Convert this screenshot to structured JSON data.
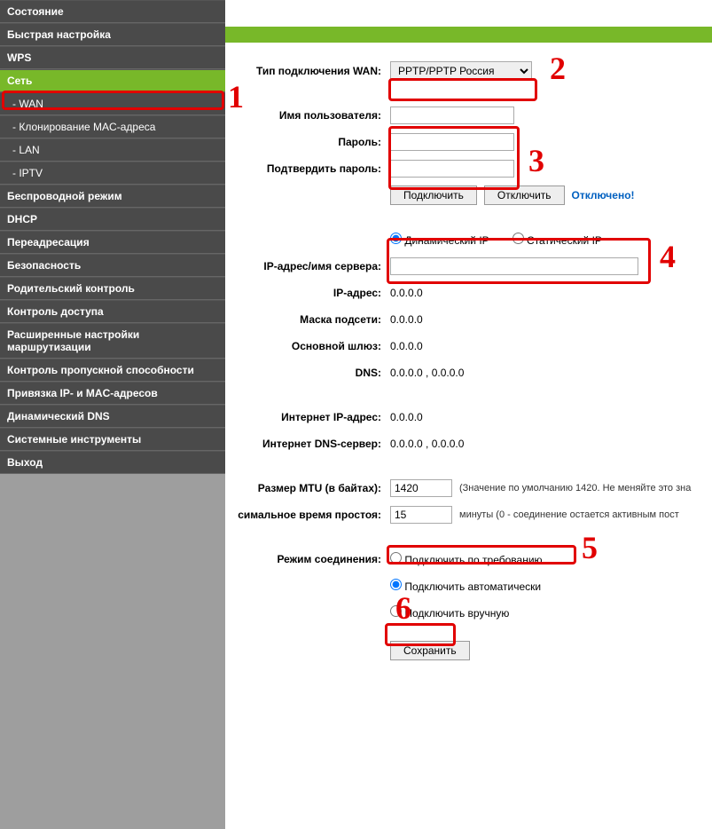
{
  "sidebar": {
    "items": [
      {
        "label": "Состояние",
        "sub": false
      },
      {
        "label": "Быстрая настройка",
        "sub": false
      },
      {
        "label": "WPS",
        "sub": false
      },
      {
        "label": "Сеть",
        "sub": false,
        "active": true
      },
      {
        "label": "- WAN",
        "sub": true,
        "selected": true
      },
      {
        "label": "- Клонирование MAC-адреса",
        "sub": true
      },
      {
        "label": "- LAN",
        "sub": true
      },
      {
        "label": "- IPTV",
        "sub": true
      },
      {
        "label": "Беспроводной режим",
        "sub": false
      },
      {
        "label": "DHCP",
        "sub": false
      },
      {
        "label": "Переадресация",
        "sub": false
      },
      {
        "label": "Безопасность",
        "sub": false
      },
      {
        "label": "Родительский контроль",
        "sub": false
      },
      {
        "label": "Контроль доступа",
        "sub": false
      },
      {
        "label": "Расширенные настройки маршрутизации",
        "sub": false
      },
      {
        "label": "Контроль пропускной способности",
        "sub": false
      },
      {
        "label": "Привязка IP- и MAC-адресов",
        "sub": false
      },
      {
        "label": "Динамический DNS",
        "sub": false
      },
      {
        "label": "Системные инструменты",
        "sub": false
      },
      {
        "label": "Выход",
        "sub": false
      }
    ]
  },
  "form": {
    "wan_type_label": "Тип подключения WAN:",
    "wan_type_value": "PPTP/PPTP Россия",
    "username_label": "Имя пользователя:",
    "username_value": "",
    "password_label": "Пароль:",
    "password_value": "",
    "confirm_label": "Подтвердить пароль:",
    "confirm_value": "",
    "connect_btn": "Подключить",
    "disconnect_btn": "Отключить",
    "status": "Отключено!",
    "dynamic_ip": "Динамический IP",
    "static_ip": "Статический IP",
    "server_label": "IP-адрес/имя сервера:",
    "server_value": "",
    "ip_label": "IP-адрес:",
    "ip_value": "0.0.0.0",
    "mask_label": "Маска подсети:",
    "mask_value": "0.0.0.0",
    "gateway_label": "Основной шлюз:",
    "gateway_value": "0.0.0.0",
    "dns_label": "DNS:",
    "dns_value": "0.0.0.0 , 0.0.0.0",
    "internet_ip_label": "Интернет IP-адрес:",
    "internet_ip_value": "0.0.0.0",
    "internet_dns_label": "Интернет DNS-сервер:",
    "internet_dns_value": "0.0.0.0 , 0.0.0.0",
    "mtu_label": "Размер MTU (в байтах):",
    "mtu_value": "1420",
    "mtu_hint": "(Значение по умолчанию 1420. Не меняйте это зна",
    "idle_label": "симальное время простоя:",
    "idle_value": "15",
    "idle_hint": "минуты (0 - соединение остается активным пост",
    "mode_label": "Режим соединения:",
    "mode_demand": "Подключить по требованию",
    "mode_auto": "Подключить автоматически",
    "mode_manual": "Подключить вручную",
    "save_btn": "Сохранить"
  },
  "annotations": {
    "n1": "1",
    "n2": "2",
    "n3": "3",
    "n4": "4",
    "n5": "5",
    "n6": "6"
  }
}
